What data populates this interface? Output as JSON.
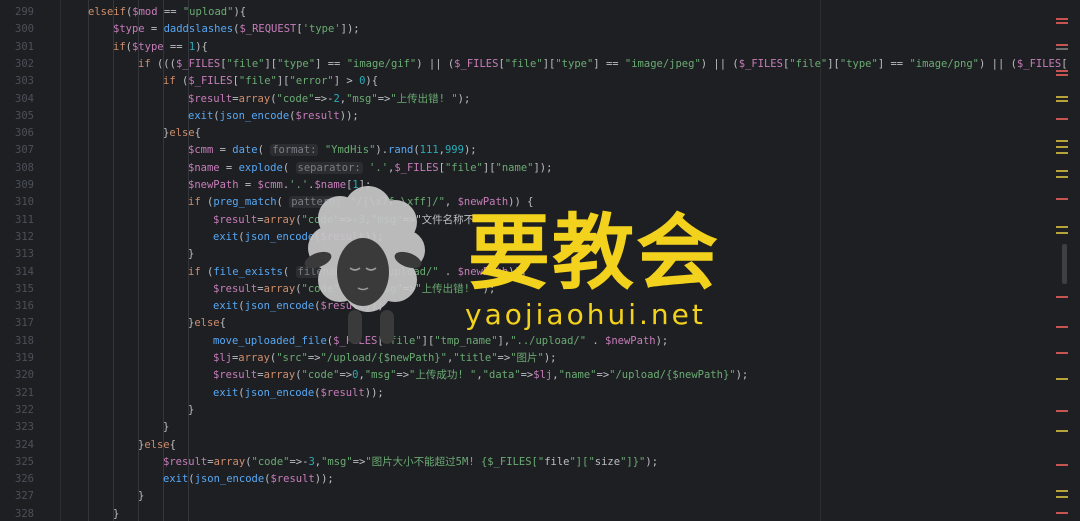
{
  "editor": {
    "lines": [
      {
        "num": "299",
        "indent": 0,
        "text": "elseif($mod == \"upload\"){"
      },
      {
        "num": "300",
        "indent": 1,
        "text": "$type = daddslashes($_REQUEST['type']);"
      },
      {
        "num": "301",
        "indent": 1,
        "text": "if($type == 1){"
      },
      {
        "num": "302",
        "indent": 2,
        "text": "if ((($_FILES[\"file\"][\"type\"] == \"image/gif\") || ($_FILES[\"file\"][\"type\"] == \"image/jpeg\") || ($_FILES[\"file\"][\"type\"] == \"image/png\") || ($_FILES["
      },
      {
        "num": "303",
        "indent": 3,
        "text": "if ($_FILES[\"file\"][\"error\"] > 0){"
      },
      {
        "num": "304",
        "indent": 4,
        "text": "$result=array(\"code\"=>-2,\"msg\"=>\"上传出错! \");"
      },
      {
        "num": "305",
        "indent": 4,
        "text": "exit(json_encode($result));"
      },
      {
        "num": "306",
        "indent": 3,
        "text": "}else{"
      },
      {
        "num": "307",
        "indent": 4,
        "text": "$cmm = date( format: \"YmdHis\").rand(111,999);"
      },
      {
        "num": "308",
        "indent": 4,
        "text": "$name = explode( separator: '.',$_FILES[\"file\"][\"name\"]);"
      },
      {
        "num": "309",
        "indent": 4,
        "text": "$newPath = $cmm.'.'.$name[1];"
      },
      {
        "num": "310",
        "indent": 4,
        "text": "if (preg_match( pattern: \"/[\\x7f-\\xff]/\", $newPath)) {"
      },
      {
        "num": "311",
        "indent": 5,
        "text": "$result=array(\"code\"=>-3,\"msg\"=>\"文件名称不"
      },
      {
        "num": "312",
        "indent": 5,
        "text": "exit(json_encode($result));"
      },
      {
        "num": "313",
        "indent": 4,
        "text": "}"
      },
      {
        "num": "314",
        "indent": 4,
        "text": "if (file_exists( filename: \"../upload/\" . $newPath)){"
      },
      {
        "num": "315",
        "indent": 5,
        "text": "$result=array(\"code\"=>-3,\"msg\"=>\"上传出错! \");"
      },
      {
        "num": "316",
        "indent": 5,
        "text": "exit(json_encode($result));"
      },
      {
        "num": "317",
        "indent": 4,
        "text": "}else{"
      },
      {
        "num": "318",
        "indent": 5,
        "text": "move_uploaded_file($_FILES[\"file\"][\"tmp_name\"],\"../upload/\" . $newPath);"
      },
      {
        "num": "319",
        "indent": 5,
        "text": "$lj=array(\"src\"=>\"/upload/{$newPath}\",\"title\"=>\"图片\");"
      },
      {
        "num": "320",
        "indent": 5,
        "text": "$result=array(\"code\"=>0,\"msg\"=>\"上传成功! \",\"data\"=>$lj,\"name\"=>\"/upload/{$newPath}\");"
      },
      {
        "num": "321",
        "indent": 5,
        "text": "exit(json_encode($result));"
      },
      {
        "num": "322",
        "indent": 4,
        "text": "}"
      },
      {
        "num": "323",
        "indent": 3,
        "text": "}"
      },
      {
        "num": "324",
        "indent": 2,
        "text": "}else{"
      },
      {
        "num": "325",
        "indent": 3,
        "text": "$result=array(\"code\"=>-3,\"msg\"=>\"图片大小不能超过5M! {$_FILES[\"file\"][\"size\"]}\");"
      },
      {
        "num": "326",
        "indent": 3,
        "text": "exit(json_encode($result));"
      },
      {
        "num": "327",
        "indent": 2,
        "text": "}"
      },
      {
        "num": "328",
        "indent": 1,
        "text": "}"
      }
    ]
  },
  "watermark": {
    "title": "要教会",
    "url": "yaojiaohui.net",
    "color": "#f3d21e"
  },
  "colors": {
    "background": "#1e1f22",
    "keyword": "#cf8e6d",
    "string": "#6aab73",
    "variable": "#c77dbb",
    "number": "#2aacb8",
    "function": "#56a8f5"
  }
}
